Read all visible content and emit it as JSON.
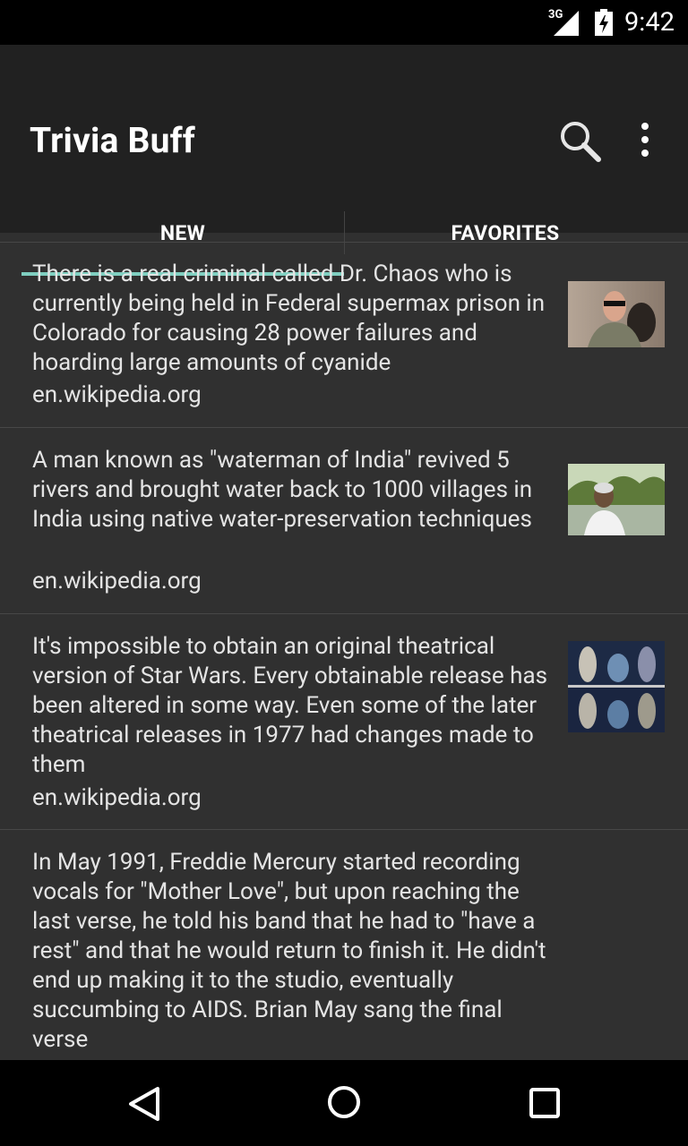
{
  "status_bar": {
    "network": "3G",
    "time": "9:42"
  },
  "app_bar": {
    "title": "Trivia Buff",
    "search_icon": "search-icon",
    "overflow_icon": "overflow-menu-icon"
  },
  "tabs": [
    {
      "label": "NEW",
      "selected": true
    },
    {
      "label": "FAVORITES",
      "selected": false
    }
  ],
  "colors": {
    "accent": "#7fcfc0",
    "appbar": "#212121",
    "background": "#303030"
  },
  "items": [
    {
      "text": "There is a real criminal called Dr. Chaos who is currently being held in Federal supermax prison in Colorado for causing 28 power failures and hoarding large amounts of cyanide",
      "source": "en.wikipedia.org",
      "thumbnail": "man-with-sunglasses"
    },
    {
      "text": "A man known as \"waterman of India\" revived 5 rivers and brought water back to 1000 villages in India using native water-preservation techniques",
      "source": "en.wikipedia.org",
      "thumbnail": "man-by-river"
    },
    {
      "text": "It's impossible to obtain an original theatrical version of Star Wars. Every obtainable release has been altered in some way. Even some of the later theatrical releases in 1977 had changes made to them",
      "source": "en.wikipedia.org",
      "thumbnail": "star-wars-ghosts"
    },
    {
      "text": "In May 1991, Freddie Mercury started recording vocals for \"Mother Love\", but upon reaching the last verse, he told his band that he had to \"have a rest\" and that he would return to finish it. He didn't end up making it to the studio, eventually succumbing to AIDS. Brian May sang the final verse",
      "source": ""
    }
  ],
  "nav": {
    "back_icon": "back-icon",
    "home_icon": "home-icon",
    "recents_icon": "recents-icon"
  }
}
